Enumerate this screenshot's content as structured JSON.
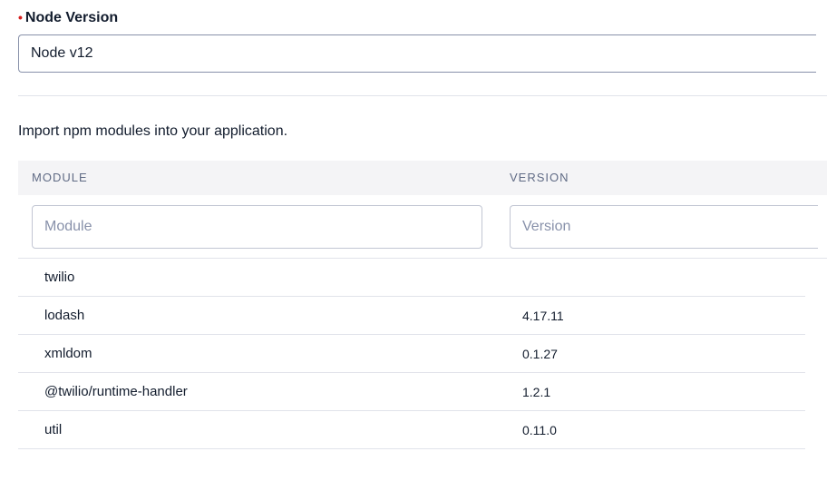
{
  "node_version": {
    "required_marker": "•",
    "label": "Node Version",
    "selected": "Node v12"
  },
  "dependencies": {
    "description": "Import npm modules into your application.",
    "headers": {
      "module": "MODULE",
      "version": "VERSION"
    },
    "new_module_placeholder": "Module",
    "new_version_placeholder": "Version",
    "rows": [
      {
        "module": "twilio",
        "version": ""
      },
      {
        "module": "lodash",
        "version": "4.17.11"
      },
      {
        "module": "xmldom",
        "version": "0.1.27"
      },
      {
        "module": "@twilio/runtime-handler",
        "version": "1.2.1"
      },
      {
        "module": "util",
        "version": "0.11.0"
      }
    ]
  },
  "colors": {
    "required": "#d61f1f",
    "header_bg": "#f4f4f6",
    "border": "#e1e3ea"
  }
}
